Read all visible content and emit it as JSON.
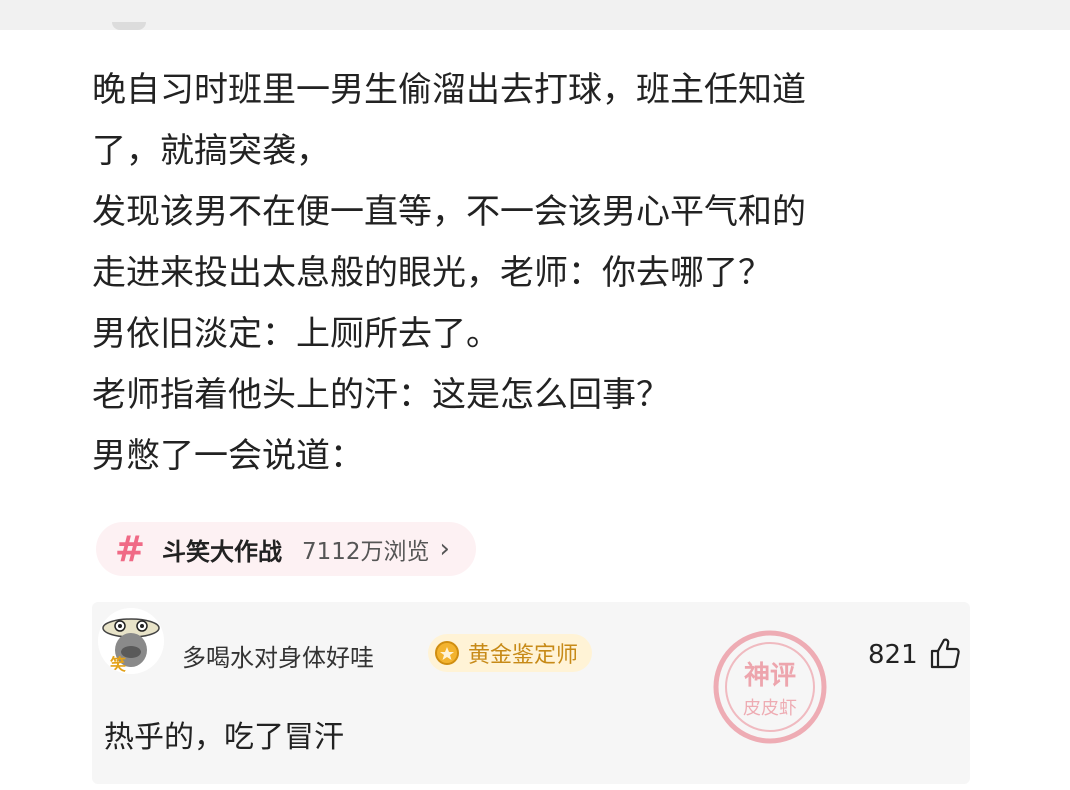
{
  "post": {
    "lines": [
      "晚自习时班里一男生偷溜出去打球，班主任知道",
      "了，就搞突袭，",
      "发现该男不在便一直等，不一会该男心平气和的",
      "走进来投出太息般的眼光，老师：你去哪了？",
      "男依旧淡定：上厕所去了。",
      "老师指着他头上的汗：这是怎么回事？",
      "男憋了一会说道："
    ]
  },
  "topic": {
    "icon": "hash-icon",
    "name": "斗笑大作战",
    "views": "7112万浏览",
    "chevron": "›"
  },
  "comment": {
    "username": "多喝水对身体好哇",
    "badge": "黄金鉴定师",
    "likes": "821",
    "text": "热乎的，吃了冒汗",
    "stamp_text_top": "神评",
    "stamp_text_bottom": "皮皮虾"
  },
  "colors": {
    "accent_pink": "#f06a86",
    "badge_gold": "#c78a17",
    "stamp_red": "#e8707e"
  }
}
